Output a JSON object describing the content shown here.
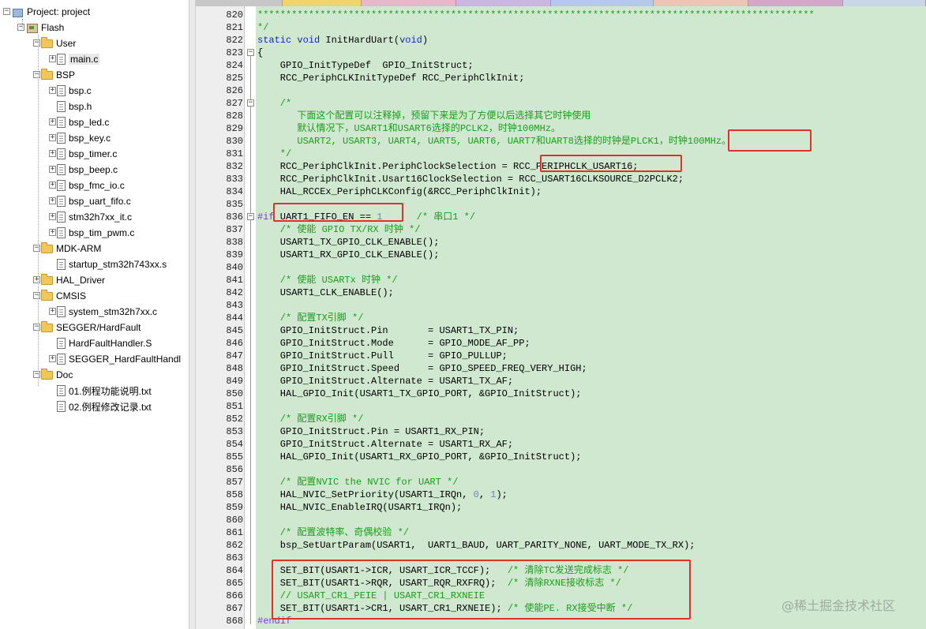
{
  "project_tree": {
    "root": "Project: project",
    "target": "Flash",
    "groups": [
      {
        "name": "User",
        "files": [
          "main.c"
        ]
      },
      {
        "name": "BSP",
        "files": [
          "bsp.c",
          "bsp.h",
          "bsp_led.c",
          "bsp_key.c",
          "bsp_timer.c",
          "bsp_beep.c",
          "bsp_fmc_io.c",
          "bsp_uart_fifo.c",
          "stm32h7xx_it.c",
          "bsp_tim_pwm.c"
        ]
      },
      {
        "name": "MDK-ARM",
        "files": [
          "startup_stm32h743xx.s"
        ]
      },
      {
        "name": "HAL_Driver",
        "files": []
      },
      {
        "name": "CMSIS",
        "files": [
          "system_stm32h7xx.c"
        ]
      },
      {
        "name": "SEGGER/HardFault",
        "files": [
          "HardFaultHandler.S",
          "SEGGER_HardFaultHandl"
        ]
      },
      {
        "name": "Doc",
        "files": [
          "01.例程功能说明.txt",
          "02.例程修改记录.txt"
        ]
      }
    ]
  },
  "editor": {
    "lines": [
      {
        "n": "820",
        "t": "**************************************************************************************************"
      },
      {
        "n": "821",
        "t": "*/"
      },
      {
        "n": "822",
        "t": "static void InitHardUart(void)"
      },
      {
        "n": "823",
        "t": "{"
      },
      {
        "n": "824",
        "t": "    GPIO_InitTypeDef  GPIO_InitStruct;"
      },
      {
        "n": "825",
        "t": "    RCC_PeriphCLKInitTypeDef RCC_PeriphClkInit;"
      },
      {
        "n": "826",
        "t": ""
      },
      {
        "n": "827",
        "t": "    /*"
      },
      {
        "n": "828",
        "t": "       下面这个配置可以注释掉，预留下来是为了方便以后选择其它时钟使用"
      },
      {
        "n": "829",
        "t": "       默认情况下，USART1和USART6选择的PCLK2，时钟100MHz。"
      },
      {
        "n": "830",
        "t": "       USART2, USART3, UART4, UART5, UART6, UART7和UART8选择的时钟是PLCK1，时钟100MHz。"
      },
      {
        "n": "831",
        "t": "    */"
      },
      {
        "n": "832",
        "t": "    RCC_PeriphClkInit.PeriphClockSelection = RCC_PERIPHCLK_USART16;"
      },
      {
        "n": "833",
        "t": "    RCC_PeriphClkInit.Usart16ClockSelection = RCC_USART16CLKSOURCE_D2PCLK2;"
      },
      {
        "n": "834",
        "t": "    HAL_RCCEx_PeriphCLKConfig(&RCC_PeriphClkInit);"
      },
      {
        "n": "835",
        "t": ""
      },
      {
        "n": "836",
        "t": "#if UART1_FIFO_EN == 1      /* 串口1 */"
      },
      {
        "n": "837",
        "t": "    /* 使能 GPIO TX/RX 时钟 */"
      },
      {
        "n": "838",
        "t": "    USART1_TX_GPIO_CLK_ENABLE();"
      },
      {
        "n": "839",
        "t": "    USART1_RX_GPIO_CLK_ENABLE();"
      },
      {
        "n": "840",
        "t": ""
      },
      {
        "n": "841",
        "t": "    /* 使能 USARTx 时钟 */"
      },
      {
        "n": "842",
        "t": "    USART1_CLK_ENABLE();"
      },
      {
        "n": "843",
        "t": ""
      },
      {
        "n": "844",
        "t": "    /* 配置TX引脚 */"
      },
      {
        "n": "845",
        "t": "    GPIO_InitStruct.Pin       = USART1_TX_PIN;"
      },
      {
        "n": "846",
        "t": "    GPIO_InitStruct.Mode      = GPIO_MODE_AF_PP;"
      },
      {
        "n": "847",
        "t": "    GPIO_InitStruct.Pull      = GPIO_PULLUP;"
      },
      {
        "n": "848",
        "t": "    GPIO_InitStruct.Speed     = GPIO_SPEED_FREQ_VERY_HIGH;"
      },
      {
        "n": "849",
        "t": "    GPIO_InitStruct.Alternate = USART1_TX_AF;"
      },
      {
        "n": "850",
        "t": "    HAL_GPIO_Init(USART1_TX_GPIO_PORT, &GPIO_InitStruct);"
      },
      {
        "n": "851",
        "t": ""
      },
      {
        "n": "852",
        "t": "    /* 配置RX引脚 */"
      },
      {
        "n": "853",
        "t": "    GPIO_InitStruct.Pin = USART1_RX_PIN;"
      },
      {
        "n": "854",
        "t": "    GPIO_InitStruct.Alternate = USART1_RX_AF;"
      },
      {
        "n": "855",
        "t": "    HAL_GPIO_Init(USART1_RX_GPIO_PORT, &GPIO_InitStruct);"
      },
      {
        "n": "856",
        "t": ""
      },
      {
        "n": "857",
        "t": "    /* 配置NVIC the NVIC for UART */"
      },
      {
        "n": "858",
        "t": "    HAL_NVIC_SetPriority(USART1_IRQn, 0, 1);"
      },
      {
        "n": "859",
        "t": "    HAL_NVIC_EnableIRQ(USART1_IRQn);"
      },
      {
        "n": "860",
        "t": ""
      },
      {
        "n": "861",
        "t": "    /* 配置波特率、奇偶校验 */"
      },
      {
        "n": "862",
        "t": "    bsp_SetUartParam(USART1,  UART1_BAUD, UART_PARITY_NONE, UART_MODE_TX_RX);"
      },
      {
        "n": "863",
        "t": ""
      },
      {
        "n": "864",
        "t": "    SET_BIT(USART1->ICR, USART_ICR_TCCF);   /* 清除TC发送完成标志 */"
      },
      {
        "n": "865",
        "t": "    SET_BIT(USART1->RQR, USART_RQR_RXFRQ);  /* 清除RXNE接收标志 */"
      },
      {
        "n": "866",
        "t": "    // USART_CR1_PEIE | USART_CR1_RXNEIE"
      },
      {
        "n": "867",
        "t": "    SET_BIT(USART1->CR1, USART_CR1_RXNEIE); /* 使能PE. RX接受中断 */"
      },
      {
        "n": "868",
        "t": "#endif"
      }
    ]
  },
  "watermark": "@稀土掘金技术社区",
  "colors": {
    "code_bg": "#cfe8cf",
    "highlight_box": "#e0302a",
    "keyword": "#1a22c8",
    "comment": "#1a9e1a"
  }
}
